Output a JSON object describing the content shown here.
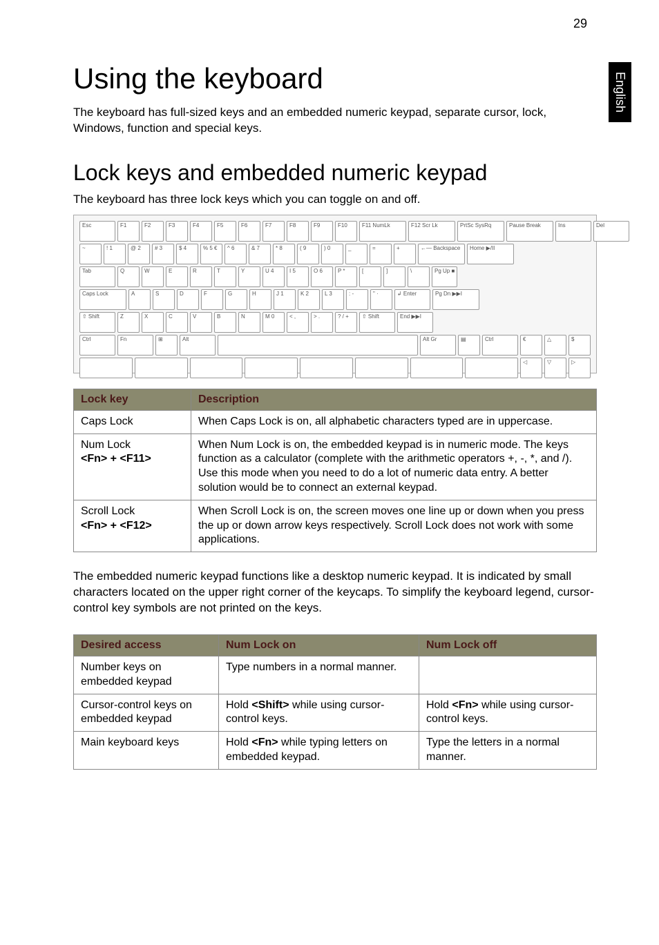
{
  "page_number": "29",
  "side_tab": "English",
  "title": "Using the keyboard",
  "intro": "The keyboard has full-sized keys and an embedded numeric keypad, separate cursor, lock, Windows, function and special keys.",
  "section_heading": "Lock keys and embedded numeric keypad",
  "section_caption": "The keyboard has three lock keys which you can toggle on and off.",
  "keyboard_rows": [
    [
      "Esc",
      "F1",
      "F2",
      "F3",
      "F4",
      "F5",
      "F6",
      "F7",
      "F8",
      "F9",
      "F10",
      "F11 NumLk",
      "F12 Scr Lk",
      "PrtSc SysRq",
      "Pause Break",
      "Ins",
      "Del"
    ],
    [
      "~",
      "! 1",
      "@ 2",
      "# 3",
      "$ 4",
      "% 5 €",
      "^ 6",
      "& 7",
      "* 8",
      "( 9",
      ") 0",
      "_",
      "=",
      "+",
      "←— Backspace",
      "Home ▶/II"
    ],
    [
      "Tab",
      "Q",
      "W",
      "E",
      "R",
      "T",
      "Y",
      "U 4",
      "I 5",
      "O 6",
      "P *",
      "[",
      "]",
      "\\",
      "Pg Up ■"
    ],
    [
      "Caps Lock",
      "A",
      "S",
      "D",
      "F",
      "G",
      "H",
      "J 1",
      "K 2",
      "L 3",
      ": -",
      "\" ·",
      "↲ Enter",
      "Pg Dn ▶▶I"
    ],
    [
      "⇧ Shift",
      "Z",
      "X",
      "C",
      "V",
      "B",
      "N",
      "M 0",
      "< ,",
      "> .",
      "? / +",
      "⇧ Shift",
      "End ▶▶I"
    ],
    [
      "Ctrl",
      "Fn",
      "⊞",
      "Alt",
      "",
      "Alt Gr",
      "▤",
      "Ctrl",
      "€",
      "△",
      "$"
    ],
    [
      "",
      "",
      "",
      "",
      "",
      "",
      "",
      "",
      "◁",
      "▽",
      "▷"
    ]
  ],
  "lock_table": {
    "headers": [
      "Lock key",
      "Description"
    ],
    "rows": [
      {
        "key": "Caps Lock",
        "sub": "",
        "desc": "When Caps Lock is on, all alphabetic characters typed are in uppercase."
      },
      {
        "key": "Num Lock",
        "sub": "<Fn> + <F11>",
        "desc": "When Num Lock is on, the embedded keypad is in numeric mode. The keys function as a calculator (complete with the arithmetic operators +, -, *, and /). Use this mode when you need to do a lot of numeric data entry. A better solution would be to connect an external keypad."
      },
      {
        "key": "Scroll Lock",
        "sub": "<Fn> + <F12>",
        "desc": "When Scroll Lock is on, the screen moves one line up or down when you press the up or down arrow keys respectively. Scroll Lock does not work with some applications."
      }
    ]
  },
  "mid_para": "The embedded numeric keypad functions like a desktop numeric keypad. It is indicated by small characters located on the upper right corner of the keycaps. To simplify the keyboard legend, cursor-control key symbols are not printed on the keys.",
  "access_table": {
    "headers": [
      "Desired access",
      "Num Lock on",
      "Num Lock off"
    ],
    "rows": [
      {
        "access": "Number keys on embedded keypad",
        "on": "Type numbers in a normal manner.",
        "off": ""
      },
      {
        "access": "Cursor-control keys on embedded keypad",
        "on_pre": "Hold ",
        "on_bold": "<Shift>",
        "on_post": " while using cursor-control keys.",
        "off_pre": "Hold ",
        "off_bold": "<Fn>",
        "off_post": " while using cursor-control keys."
      },
      {
        "access": "Main keyboard keys",
        "on_pre": "Hold ",
        "on_bold": "<Fn>",
        "on_post": " while typing letters on embedded keypad.",
        "off": "Type the letters in a normal manner."
      }
    ]
  }
}
